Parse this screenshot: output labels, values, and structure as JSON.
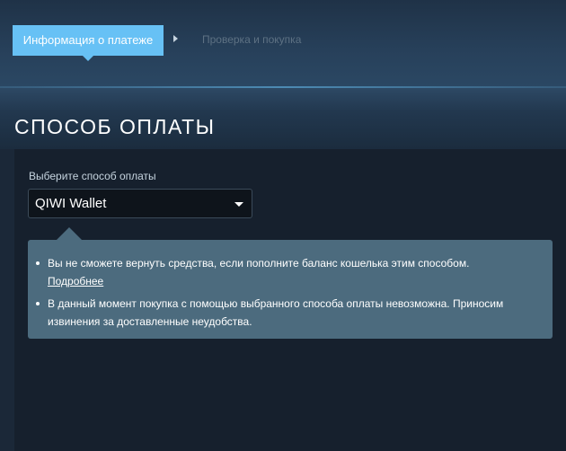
{
  "steps": {
    "active_label": "Информация о платеже",
    "next_label": "Проверка и покупка"
  },
  "page": {
    "title": "СПОСОБ ОПЛАТЫ"
  },
  "payment": {
    "select_label": "Выберите способ оплаты",
    "selected_method": "QIWI Wallet"
  },
  "notice": {
    "items": [
      {
        "text": "Вы не сможете вернуть средства, если пополните баланс кошелька этим способом.",
        "link": "Подробнее"
      },
      {
        "text": "В данный момент покупка с помощью выбранного способа оплаты невозможна. Приносим извинения за доставленные неудобства."
      }
    ]
  },
  "colors": {
    "accent": "#67c1f5",
    "background": "#1b2838",
    "panel": "#16202d",
    "notice": "#4c6b7e"
  }
}
